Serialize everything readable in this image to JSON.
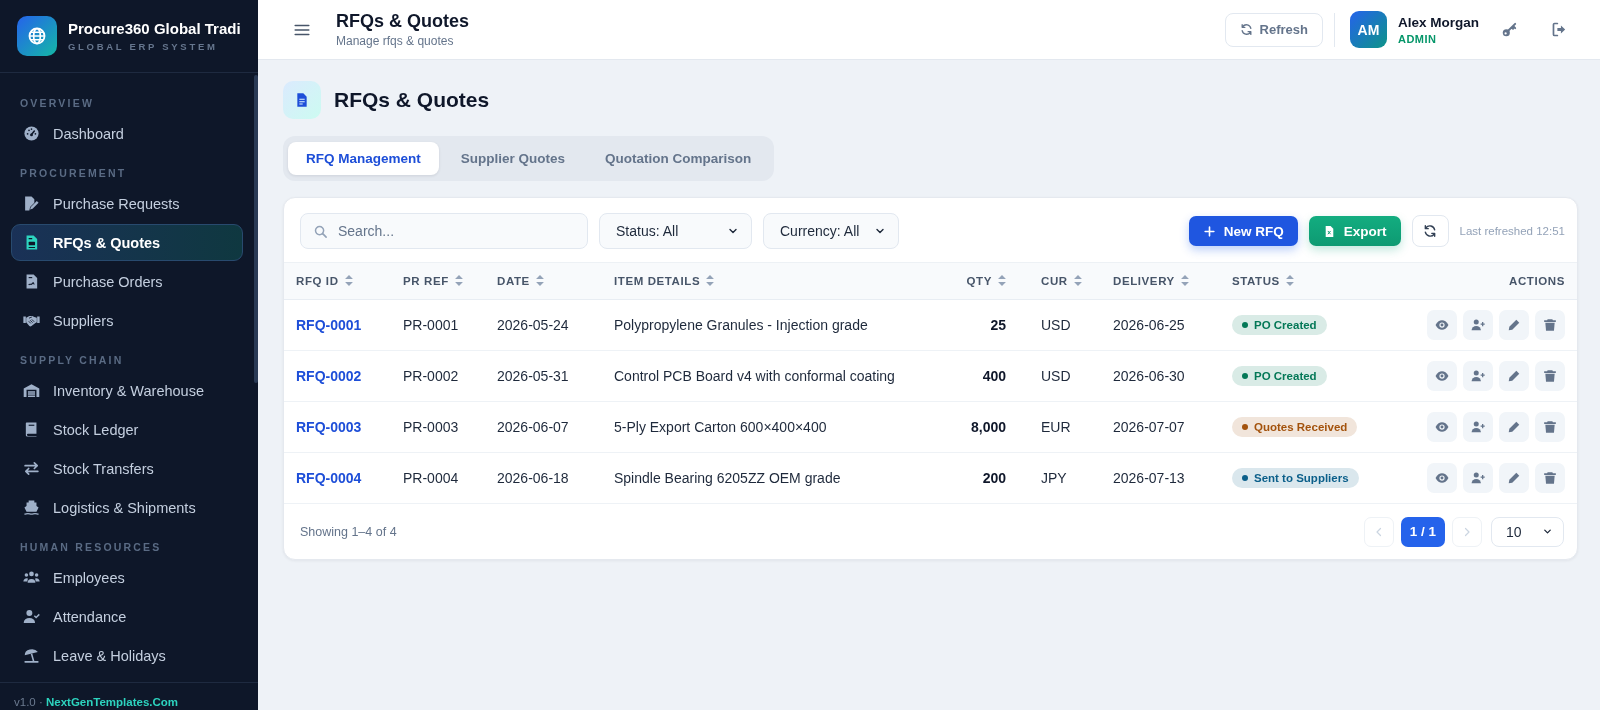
{
  "sidebar": {
    "brand": {
      "title": "Procure360 Global Tradi",
      "subtitle": "GLOBAL ERP SYSTEM"
    },
    "sections": [
      {
        "title": "OVERVIEW",
        "items": [
          {
            "label": "Dashboard",
            "selected": false
          }
        ]
      },
      {
        "title": "PROCUREMENT",
        "items": [
          {
            "label": "Purchase Requests",
            "selected": false
          },
          {
            "label": "RFQs & Quotes",
            "selected": true
          },
          {
            "label": "Purchase Orders",
            "selected": false
          },
          {
            "label": "Suppliers",
            "selected": false
          }
        ]
      },
      {
        "title": "SUPPLY CHAIN",
        "items": [
          {
            "label": "Inventory & Warehouse",
            "selected": false
          },
          {
            "label": "Stock Ledger",
            "selected": false
          },
          {
            "label": "Stock Transfers",
            "selected": false
          },
          {
            "label": "Logistics & Shipments",
            "selected": false
          }
        ]
      },
      {
        "title": "HUMAN RESOURCES",
        "items": [
          {
            "label": "Employees",
            "selected": false
          },
          {
            "label": "Attendance",
            "selected": false
          },
          {
            "label": "Leave & Holidays",
            "selected": false
          }
        ]
      }
    ],
    "footer": {
      "version": "v1.0 ·",
      "link": "NextGenTemplates.Com"
    }
  },
  "header": {
    "title": "RFQs & Quotes",
    "subtitle": "Manage rfqs & quotes",
    "refresh_button": "Refresh",
    "user": {
      "initials": "AM",
      "name": "Alex Morgan",
      "role": "ADMIN"
    }
  },
  "page": {
    "title": "RFQs & Quotes",
    "tabs": [
      {
        "label": "RFQ Management",
        "selected": true
      },
      {
        "label": "Supplier Quotes",
        "selected": false
      },
      {
        "label": "Quotation Comparison",
        "selected": false
      }
    ],
    "toolbar": {
      "search": {
        "placeholder": "Search..."
      },
      "filters": [
        {
          "value": "Status: All"
        },
        {
          "value": "Currency: All"
        }
      ],
      "buttons": [
        {
          "kind": "primary",
          "label": "New RFQ"
        },
        {
          "kind": "success",
          "label": "Export"
        }
      ],
      "last_refreshed": "Last refreshed 12:51"
    },
    "table": {
      "columns": [
        {
          "label": "RFQ ID",
          "kind": "id",
          "sortable": true
        },
        {
          "label": "PR REF",
          "kind": "text",
          "sortable": true
        },
        {
          "label": "DATE",
          "kind": "text",
          "sortable": true
        },
        {
          "label": "ITEM DETAILS",
          "kind": "text",
          "sortable": true
        },
        {
          "label": "QTY",
          "kind": "number",
          "sortable": true
        },
        {
          "label": "CUR",
          "kind": "text",
          "sortable": true
        },
        {
          "label": "DELIVERY",
          "kind": "text",
          "sortable": true
        },
        {
          "label": "STATUS",
          "kind": "status",
          "sortable": true
        },
        {
          "label": "ACTIONS",
          "kind": "actions",
          "sortable": false
        }
      ],
      "rows": [
        {
          "cells": [
            "RFQ-0001",
            "PR-0001",
            "2026-05-24",
            "Polypropylene Granules - Injection grade",
            "25",
            "USD",
            "2026-06-25"
          ],
          "status": {
            "label": "PO Created",
            "color": "#047857"
          }
        },
        {
          "cells": [
            "RFQ-0002",
            "PR-0002",
            "2026-05-31",
            "Control PCB Board v4 with conformal coating",
            "400",
            "USD",
            "2026-06-30"
          ],
          "status": {
            "label": "PO Created",
            "color": "#047857"
          }
        },
        {
          "cells": [
            "RFQ-0003",
            "PR-0003",
            "2026-06-07",
            "5-Ply Export Carton 600×400×400",
            "8,000",
            "EUR",
            "2026-07-07"
          ],
          "status": {
            "label": "Quotes Received",
            "color": "#a3520c"
          }
        },
        {
          "cells": [
            "RFQ-0004",
            "PR-0004",
            "2026-06-18",
            "Spindle Bearing 6205ZZ OEM grade",
            "200",
            "JPY",
            "2026-07-13"
          ],
          "status": {
            "label": "Sent to Suppliers",
            "color": "#0b5f8a"
          }
        }
      ]
    },
    "footer": {
      "summary": "Showing 1–4 of 4",
      "pagination": {
        "previous": {
          "disabled": true
        },
        "page": "1 / 1",
        "next": {
          "disabled": true
        },
        "page_size": "10"
      }
    }
  }
}
